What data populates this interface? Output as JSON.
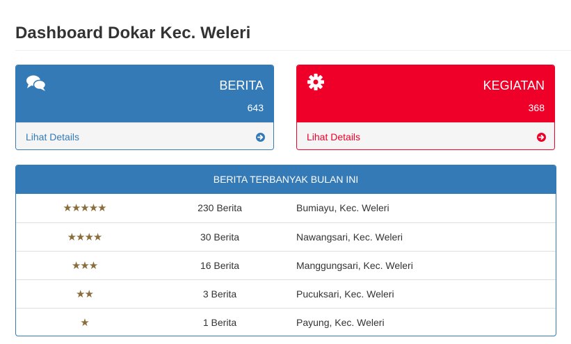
{
  "page": {
    "title": "Dashboard Dokar Kec. Weleri"
  },
  "cards": {
    "berita": {
      "label": "BERITA",
      "count": "643",
      "link": "Lihat Details",
      "icon": "comments-icon",
      "color": "#337ab7"
    },
    "kegiatan": {
      "label": "KEGIATAN",
      "count": "368",
      "link": "Lihat Details",
      "icon": "gear-icon",
      "color": "#ee0029"
    }
  },
  "ranking": {
    "header": "BERITA TERBANYAK BULAN INI",
    "star_color": "#8a6d3b",
    "rows": [
      {
        "stars": "★★★★★",
        "rating": 5,
        "count": "230 Berita",
        "place": "Bumiayu, Kec. Weleri"
      },
      {
        "stars": "★★★★",
        "rating": 4,
        "count": "30 Berita",
        "place": "Nawangsari, Kec. Weleri"
      },
      {
        "stars": "★★★",
        "rating": 3,
        "count": "16 Berita",
        "place": "Manggungsari, Kec. Weleri"
      },
      {
        "stars": "★★",
        "rating": 2,
        "count": "3 Berita",
        "place": "Pucuksari, Kec. Weleri"
      },
      {
        "stars": "★",
        "rating": 1,
        "count": "1 Berita",
        "place": "Payung, Kec. Weleri"
      }
    ]
  }
}
